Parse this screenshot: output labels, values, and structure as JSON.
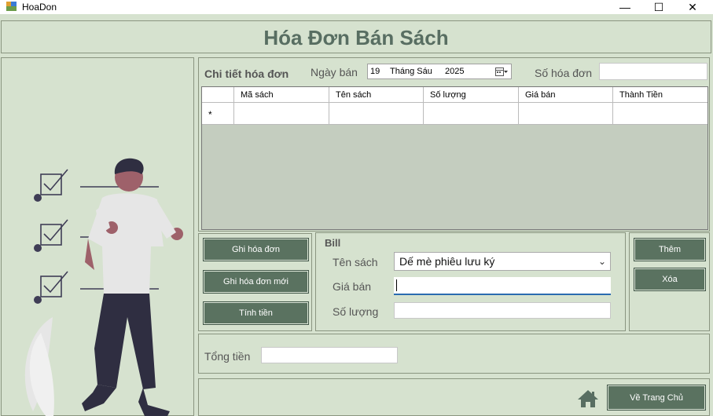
{
  "window": {
    "title": "HoaDon",
    "minimize": "—",
    "maximize": "☐",
    "close": "✕"
  },
  "header": {
    "title": "Hóa Đơn Bán Sách"
  },
  "detail": {
    "section_label": "Chi tiết hóa đơn",
    "date_label": "Ngày bán",
    "date_day": "19",
    "date_month": "Tháng Sáu",
    "date_year": "2025",
    "invoice_label": "Số hóa đơn",
    "invoice_value": ""
  },
  "grid": {
    "columns": [
      "Mã sách",
      "Tên sách",
      "Số lượng",
      "Giá bán",
      "Thành Tiền"
    ],
    "new_row_marker": "*"
  },
  "actions": {
    "save_invoice": "Ghi hóa đơn",
    "new_invoice": "Ghi hóa đơn mới",
    "calc": "Tính tiền"
  },
  "bill": {
    "section_label": "Bill",
    "book_label": "Tên sách",
    "book_selected": "Dế mè phiêu lưu ký",
    "price_label": "Giá bán",
    "price_value": "",
    "qty_label": "Số lượng",
    "qty_value": ""
  },
  "addrem": {
    "add": "Thêm",
    "remove": "Xóa"
  },
  "total": {
    "label": "Tổng tiền",
    "value": ""
  },
  "footer": {
    "home_button": "Về Trang Chủ"
  }
}
